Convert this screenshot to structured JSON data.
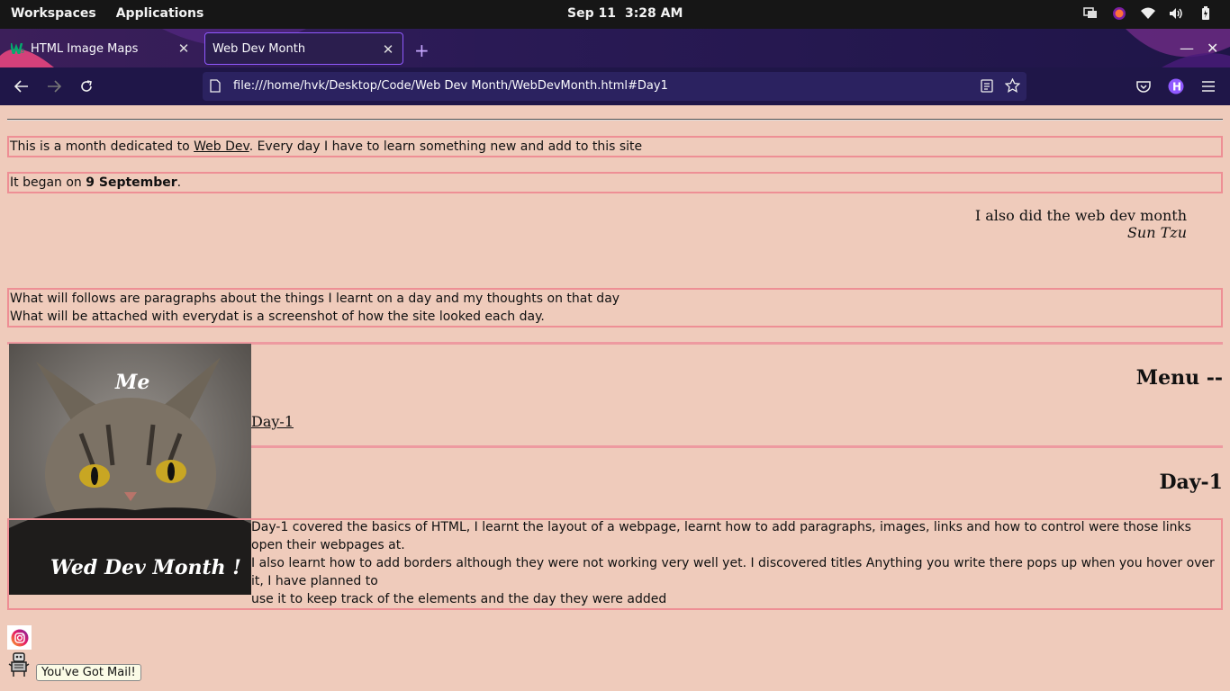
{
  "topbar": {
    "workspaces": "Workspaces",
    "applications": "Applications",
    "date": "Sep 11",
    "time": "3:28 AM"
  },
  "tabs": [
    {
      "title": "HTML Image Maps",
      "active": false
    },
    {
      "title": "Web Dev Month",
      "active": true
    }
  ],
  "url": "file:///home/hvk/Desktop/Code/Web Dev Month/WebDevMonth.html#Day1",
  "page": {
    "intro_pre": "This is a month dedicated to ",
    "intro_link": "Web Dev",
    "intro_post": ". Every day I have to learn something new and add to this site",
    "began_pre": "It began on ",
    "began_date": "9 September",
    "began_post": ".",
    "quote": "I also did the web dev month",
    "quote_author": "Sun Tzu",
    "follows_line1": "What will follows are paragraphs about the things I learnt on a day and my thoughts on that day",
    "follows_line2": "What will be attached with everydat is a screenshot of how the site looked each day.",
    "image_top_text": "Me",
    "image_bottom_text": "Wed Dev Month !",
    "menu_heading": "Menu --",
    "menu_link": "Day-1",
    "day_heading": "Day-1",
    "day_line1": "Day-1 covered the basics of HTML, I learnt the layout of a webpage, learnt how to add paragraphs, images, links and how to control were those links open their webpages at.",
    "day_line2": "I also learnt how to add borders although they were not working very well yet. I discovered titles Anything you write there pops up when you hover over it, I have planned to",
    "day_line3": "use it to keep track of the elements and the day they were added",
    "tooltip": "You've Got Mail!"
  }
}
